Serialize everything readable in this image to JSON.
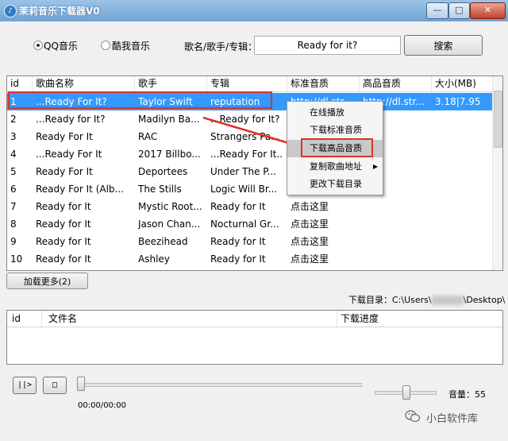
{
  "window": {
    "title": "茉莉音乐下载器V0",
    "icon": "music-app-icon",
    "controls": {
      "minimize": "—",
      "maximize": "□",
      "close": "✕"
    }
  },
  "search": {
    "sources": [
      {
        "label": "QQ音乐",
        "selected": true
      },
      {
        "label": "酷我音乐",
        "selected": false
      }
    ],
    "field_label": "歌名/歌手/专辑：",
    "value": "Ready for it?",
    "button": "搜索"
  },
  "results": {
    "columns": [
      "id",
      "歌曲名称",
      "歌手",
      "专辑",
      "标准音质",
      "高品音质",
      "大小(MB)"
    ],
    "rows": [
      {
        "id": "1",
        "name": "...Ready For It?",
        "singer": "Taylor Swift",
        "album": "reputation",
        "standard": "http://dl.str...",
        "high": "http://dl.str...",
        "size": "3.18|7.95",
        "selected": true
      },
      {
        "id": "2",
        "name": "...Ready for It?",
        "singer": "Madilyn Ba...",
        "album": "...Ready for It?",
        "standard": "",
        "high": "",
        "size": ""
      },
      {
        "id": "3",
        "name": "Ready For It",
        "singer": "RAC",
        "album": "Strangers Pa...",
        "standard": "",
        "high": "",
        "size": ""
      },
      {
        "id": "4",
        "name": "...Ready For It",
        "singer": "2017 Billbo...",
        "album": "...Ready For It...",
        "standard": "",
        "high": "",
        "size": ""
      },
      {
        "id": "5",
        "name": "Ready For It",
        "singer": "Deportees",
        "album": "Under The P...",
        "standard": "",
        "high": "",
        "size": ""
      },
      {
        "id": "6",
        "name": "Ready For It (Alb...",
        "singer": "The Stills",
        "album": "Logic Will Br...",
        "standard": "",
        "high": "",
        "size": ""
      },
      {
        "id": "7",
        "name": "Ready for It",
        "singer": "Mystic Root...",
        "album": "Ready for It",
        "standard": "点击这里",
        "high": "",
        "size": ""
      },
      {
        "id": "8",
        "name": "Ready for It",
        "singer": "Jason Chan...",
        "album": "Nocturnal Gr...",
        "standard": "点击这里",
        "high": "",
        "size": ""
      },
      {
        "id": "9",
        "name": "Ready for It",
        "singer": "Beezihead",
        "album": "Ready for It",
        "standard": "点击这里",
        "high": "",
        "size": ""
      },
      {
        "id": "10",
        "name": "Ready for It",
        "singer": "Ashley",
        "album": "Ready for It",
        "standard": "点击这里",
        "high": "",
        "size": ""
      }
    ]
  },
  "context_menu": {
    "items": [
      {
        "label": "在线播放",
        "submenu": false
      },
      {
        "label": "下载标准音质",
        "submenu": false
      },
      {
        "label": "下载高品音质",
        "submenu": false,
        "active": true
      },
      {
        "label": "复制歌曲地址",
        "submenu": true
      },
      {
        "label": "更改下载目录",
        "submenu": false
      }
    ]
  },
  "load_more": "加载更多(2)",
  "download_dir": {
    "prefix": "下载目录：C:\\Users\\",
    "suffix": "\\Desktop\\"
  },
  "download_list": {
    "columns": [
      "id",
      "文件名",
      "下载进度"
    ]
  },
  "player": {
    "play": "||>",
    "stop": "□",
    "time": "00:00/00:00",
    "progress": 0,
    "volume_label": "音量：",
    "volume": "55",
    "volume_fraction": 0.55
  },
  "watermark": {
    "text": "小白软件库",
    "icon": "wechat-icon"
  },
  "colors": {
    "selection": "#3399ff",
    "highlight": "#e0302a",
    "titlebar": "#7fb0db"
  }
}
